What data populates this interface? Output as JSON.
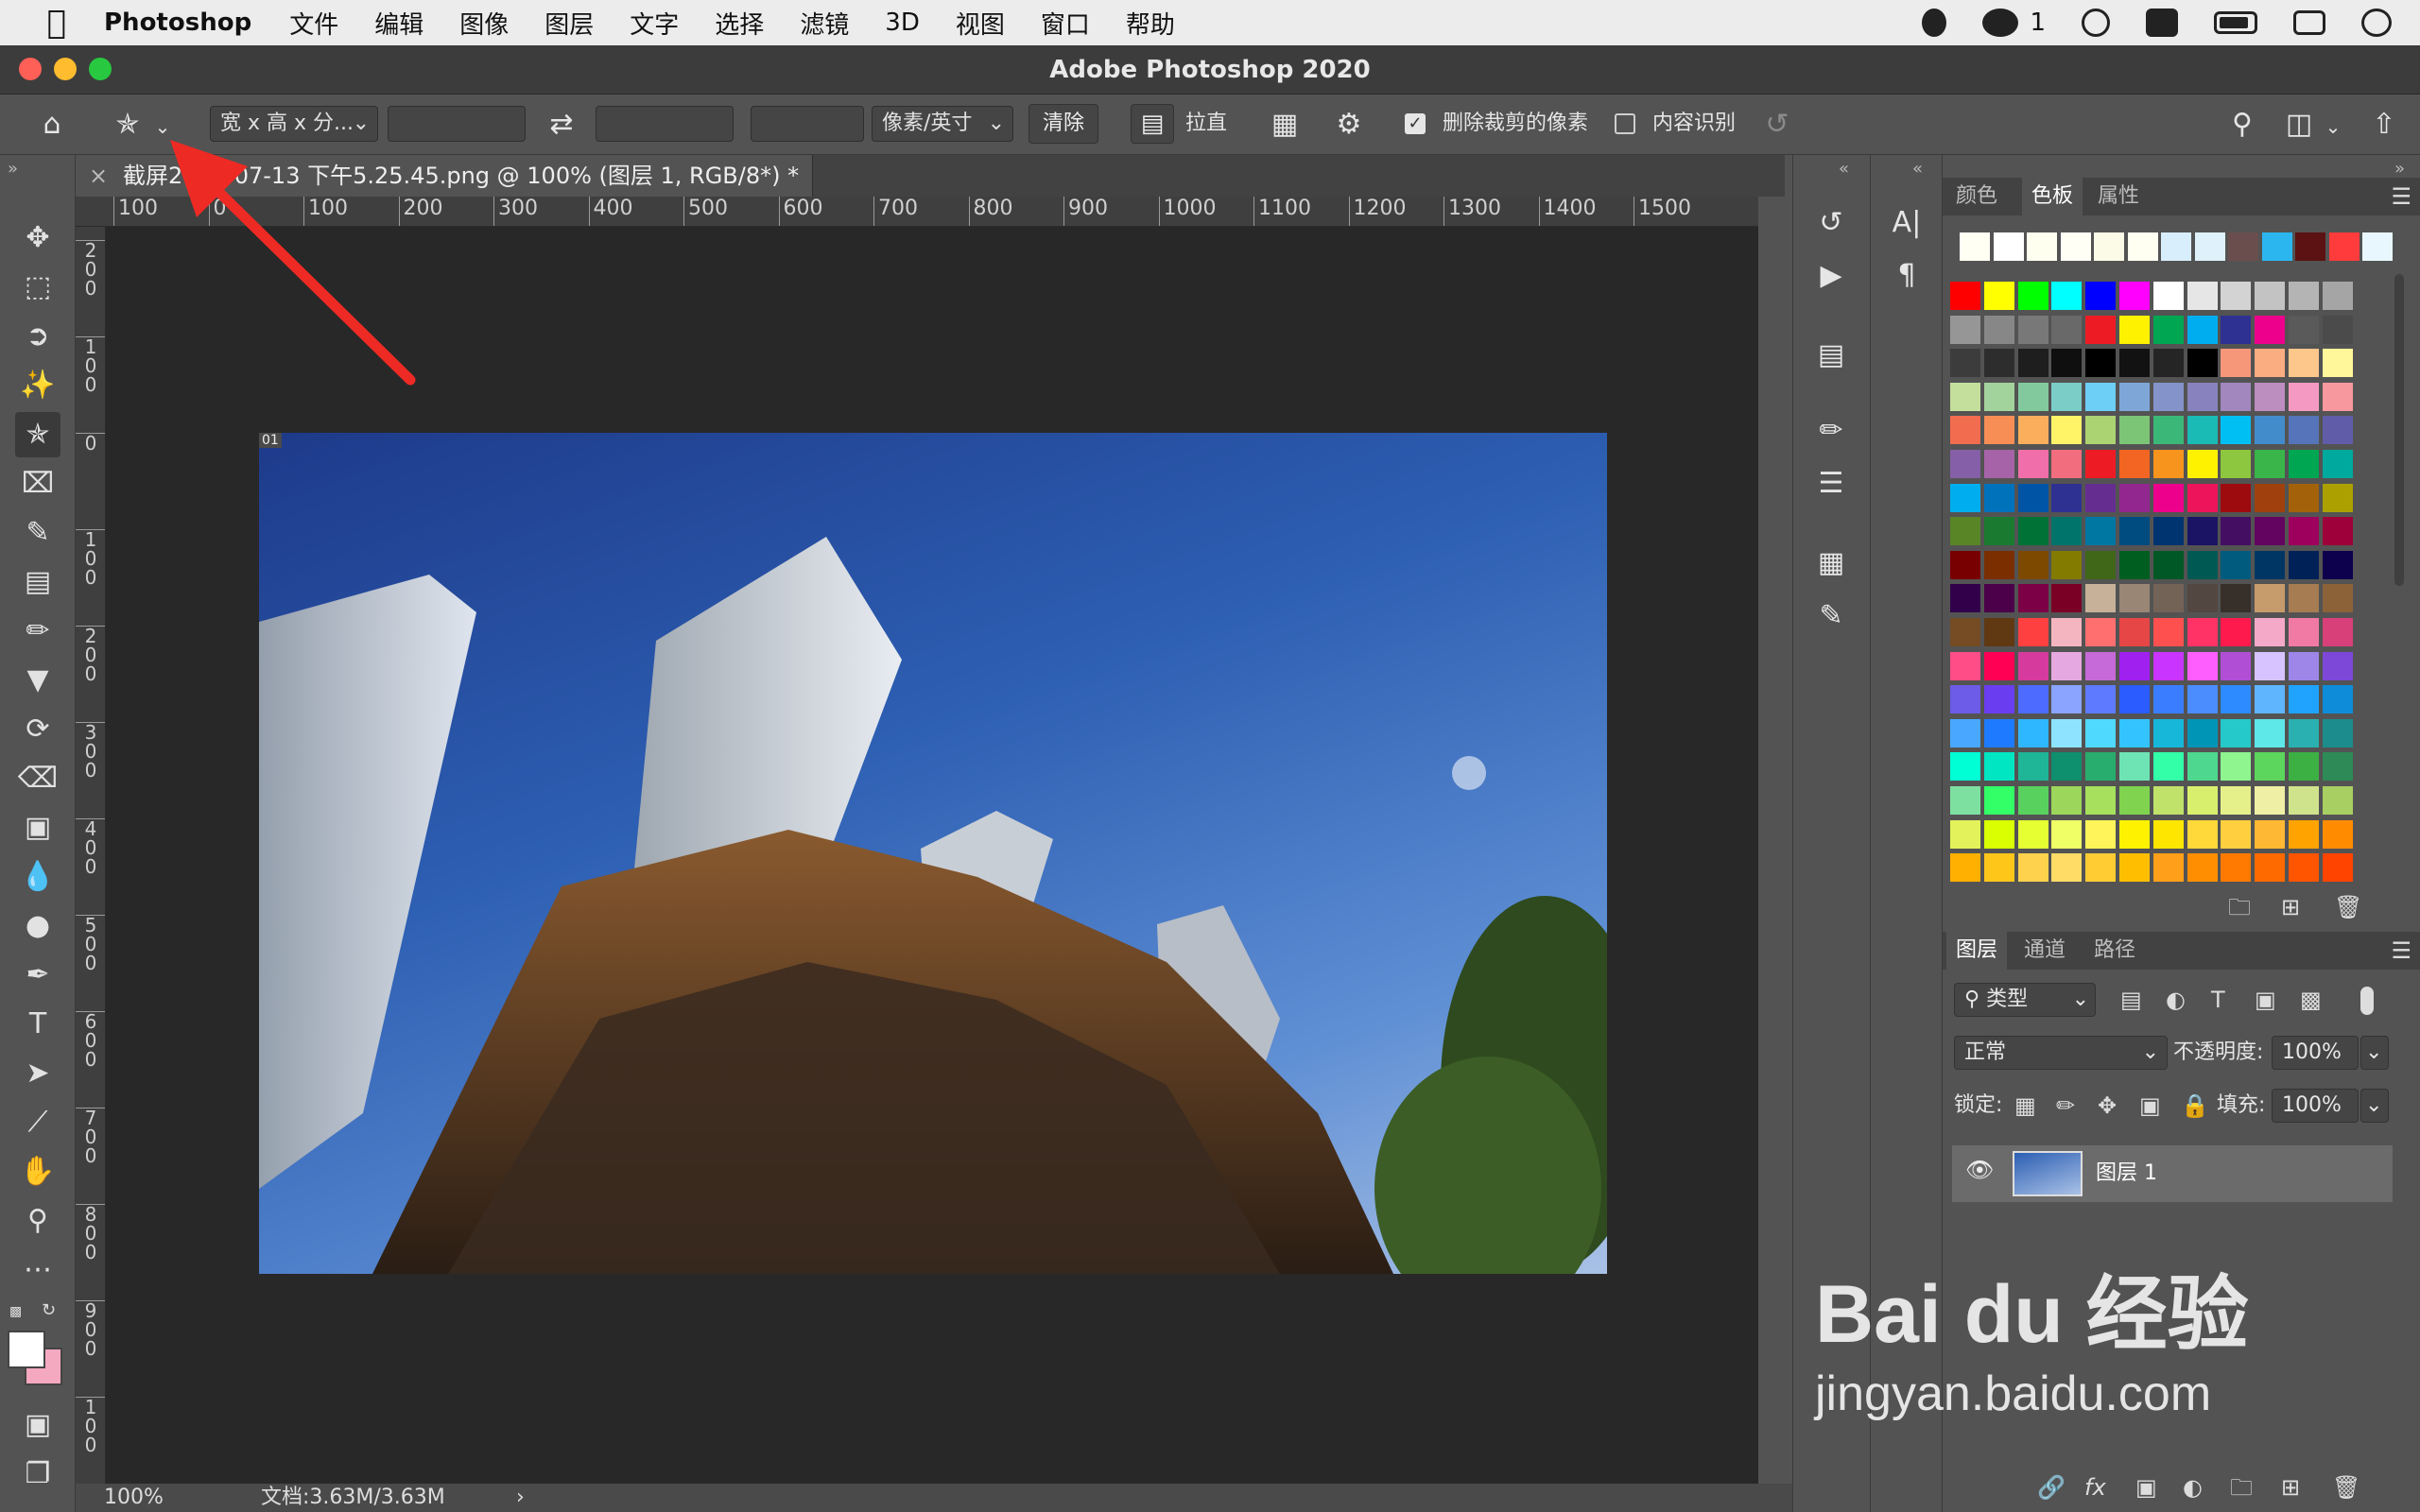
{
  "menubar": {
    "app_name": "Photoshop",
    "items": [
      "文件",
      "编辑",
      "图像",
      "图层",
      "文字",
      "选择",
      "滤镜",
      "3D",
      "视图",
      "窗口",
      "帮助"
    ],
    "wechat_count": "1"
  },
  "window": {
    "title": "Adobe Photoshop 2020"
  },
  "options": {
    "ratio_select": "宽 x 高 x 分...",
    "unit_select": "像素/英寸",
    "clear": "清除",
    "straighten": "拉直",
    "delete_cropped_label": "删除裁剪的像素",
    "delete_cropped_checked": true,
    "content_aware_label": "内容识别",
    "content_aware_checked": false
  },
  "document": {
    "tab_close": "×",
    "tab_name": "截屏2020-07-13 下午5.25.45.png @ 100% (图层 1, RGB/8*) *",
    "layer_badge": "01"
  },
  "ruler": {
    "h_labels": [
      "100",
      "0",
      "100",
      "200",
      "300",
      "400",
      "500",
      "600",
      "700",
      "800",
      "900",
      "1000",
      "1100",
      "1200",
      "1300",
      "1400",
      "1500"
    ],
    "v_labels": [
      "2 0 0",
      "1 0 0",
      "0",
      "1 0 0",
      "2 0 0",
      "3 0 0",
      "4 0 0",
      "5 0 0",
      "6 0 0",
      "7 0 0",
      "8 0 0",
      "9 0 0",
      "1 0 0"
    ]
  },
  "status": {
    "zoom": "100%",
    "doc_size": "文档:3.63M/3.63M"
  },
  "swatch_panel": {
    "tabs": [
      "颜色",
      "色板",
      "属性"
    ],
    "active_tab": "色板",
    "recent": [
      "#fffff3",
      "#ffffff",
      "#fffff0",
      "#fffff6",
      "#fcfbe8",
      "#fffff2",
      "#d8eefc",
      "#dff1fa",
      "#6a4e4e",
      "#2cb6f0",
      "#5c1212",
      "#ff3b3b",
      "#e8f7fe"
    ],
    "grid": [
      [
        "#ff0000",
        "#ffff00",
        "#00ff00",
        "#00ffff",
        "#0000ff",
        "#ff00ff",
        "#ffffff",
        "#e6e6e6",
        "#d3d3d3",
        "#c3c3c3",
        "#b4b4b4",
        "#a5a5a5"
      ],
      [
        "#969696",
        "#878787",
        "#787878",
        "#696969",
        "#ed1c24",
        "#fff200",
        "#00a651",
        "#00aeef",
        "#2e3192",
        "#ec008c",
        "#5a5a5a",
        "#4b4b4b"
      ],
      [
        "#3c3c3c",
        "#2d2d2d",
        "#1e1e1e",
        "#0f0f0f",
        "#000000",
        "#121212",
        "#252525",
        "#000000",
        "#f7977a",
        "#f9ad81",
        "#fdc68a",
        "#fff79a"
      ],
      [
        "#c4df9b",
        "#a3d39c",
        "#82ca9d",
        "#7bcdc8",
        "#6ecff6",
        "#7ea7d8",
        "#8493ca",
        "#8882be",
        "#a187be",
        "#bc8dbf",
        "#f49ac2",
        "#f6989d"
      ],
      [
        "#f26c4f",
        "#f68e55",
        "#fbaf5c",
        "#fff467",
        "#acd372",
        "#7cc576",
        "#3bb878",
        "#1abbb4",
        "#00bff3",
        "#438ccb",
        "#5574b9",
        "#605ca8"
      ],
      [
        "#855fa8",
        "#a763a8",
        "#f06ea9",
        "#f26d7d",
        "#ed1c24",
        "#f26522",
        "#f7941d",
        "#fff200",
        "#8dc63f",
        "#39b54a",
        "#00a651",
        "#00a99d"
      ],
      [
        "#00aeef",
        "#0072bc",
        "#0054a6",
        "#2e3192",
        "#662d91",
        "#92278f",
        "#ec008c",
        "#ed145b",
        "#9e0b0f",
        "#a0410d",
        "#a3620a",
        "#aba000"
      ],
      [
        "#598527",
        "#1a7b30",
        "#007236",
        "#00746b",
        "#0076a3",
        "#004b80",
        "#003471",
        "#1b1464",
        "#440e62",
        "#630460",
        "#9e005d",
        "#9e0039"
      ],
      [
        "#790000",
        "#7b2e00",
        "#7d4900",
        "#827b00",
        "#406618",
        "#005e20",
        "#005826",
        "#005952",
        "#005b7f",
        "#003663",
        "#002157",
        "#0d004c"
      ],
      [
        "#32004b",
        "#4b0049",
        "#7b0046",
        "#7a0026",
        "#c7b299",
        "#998675",
        "#736357",
        "#534741",
        "#37302a",
        "#c69c6d",
        "#a67c52",
        "#8c6239"
      ],
      [
        "#754c24",
        "#603913",
        "#ff4040",
        "#f5b5c0",
        "#ff6f6f",
        "#e64646",
        "#ff5050",
        "#ff3366",
        "#ff1a4d",
        "#f5a9c8",
        "#f07aa4",
        "#d84079"
      ],
      [
        "#ff4d88",
        "#ff0055",
        "#d63a9d",
        "#e6a8e0",
        "#c56ad8",
        "#a020f0",
        "#c934ff",
        "#ff5eff",
        "#b04fd6",
        "#d6c3ff",
        "#9e86e8",
        "#7d48d8"
      ],
      [
        "#6c5ce7",
        "#6a3df0",
        "#4d6bff",
        "#8aa4ff",
        "#5e7bff",
        "#2a5cff",
        "#3b7dff",
        "#4b8dff",
        "#2e8bff",
        "#5fb6ff",
        "#1fa3ff",
        "#0f8cd9"
      ],
      [
        "#4aa7ff",
        "#1e7bff",
        "#2eb6ff",
        "#8ee4ff",
        "#4fd9ff",
        "#33c4ff",
        "#17b7d9",
        "#0095b6",
        "#26c9c9",
        "#5ee8e8",
        "#2ab0b0",
        "#1c8c8c"
      ],
      [
        "#00ffd5",
        "#00e6c3",
        "#1fb597",
        "#0e8f6d",
        "#28ad6e",
        "#6ee3b4",
        "#33ffa8",
        "#4ed88f",
        "#8ef58f",
        "#5cd65c",
        "#3cb043",
        "#2e8b57"
      ],
      [
        "#7ee0a0",
        "#33ff66",
        "#59d15e",
        "#9cd65a",
        "#a6e05c",
        "#7fd34e",
        "#c0e26a",
        "#d8ef6e",
        "#e6f08a",
        "#efefa6",
        "#cfe38c",
        "#a8cf62"
      ],
      [
        "#e3f25a",
        "#d9ff00",
        "#e6ff33",
        "#f0ff66",
        "#fff55a",
        "#fff200",
        "#ffe600",
        "#ffd83a",
        "#ffcf40",
        "#ffb833",
        "#ffa300",
        "#ff8c00"
      ],
      [
        "#ffb000",
        "#ffc61a",
        "#ffd24d",
        "#ffdc66",
        "#ffcc33",
        "#ffbf00",
        "#ff9f1a",
        "#ff8f00",
        "#ff7a00",
        "#ff6a00",
        "#ff5500",
        "#ff4400"
      ]
    ]
  },
  "layers_panel": {
    "tabs": [
      "图层",
      "通道",
      "路径"
    ],
    "active_tab": "图层",
    "filter": "类型",
    "blend_mode": "正常",
    "opacity_label": "不透明度:",
    "opacity_value": "100%",
    "lock_label": "锁定:",
    "fill_label": "填充:",
    "fill_value": "100%",
    "layers": [
      {
        "name": "图层 1",
        "visible": true
      }
    ]
  },
  "watermark": {
    "brand": "Bai du 经验",
    "url": "jingyan.baidu.com"
  }
}
